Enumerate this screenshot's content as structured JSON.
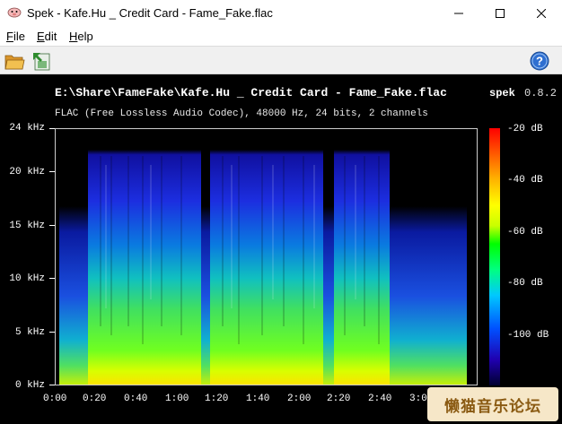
{
  "window": {
    "title": "Spek - Kafe.Hu _ Credit Card - Fame_Fake.flac",
    "icon": "pig-app-icon"
  },
  "menu": [
    {
      "label": "File",
      "accel": "F",
      "rest": "ile"
    },
    {
      "label": "Edit",
      "accel": "E",
      "rest": "dit"
    },
    {
      "label": "Help",
      "accel": "H",
      "rest": "elp"
    }
  ],
  "toolbar": {
    "open_icon": "folder-open-icon",
    "save_icon": "save-screenshot-icon",
    "help_icon": "help-icon"
  },
  "spectrogram": {
    "filename": "E:\\Share\\FameFake\\Kafe.Hu _ Credit Card - Fame_Fake.flac",
    "brand": "spek",
    "version": "0.8.2",
    "info": "FLAC (Free Lossless Audio Codec), 48000 Hz, 24 bits, 2 channels",
    "y_ticks": [
      "24 kHz",
      "20 kHz",
      "15 kHz",
      "10 kHz",
      "5 kHz",
      "0 kHz"
    ],
    "x_ticks": [
      "0:00",
      "0:20",
      "0:40",
      "1:00",
      "1:20",
      "1:40",
      "2:00",
      "2:20",
      "2:40",
      "3:00"
    ],
    "db_ticks": [
      "-20 dB",
      "-40 dB",
      "-60 dB",
      "-80 dB",
      "-100 dB"
    ]
  },
  "watermark": "懒猫音乐论坛"
}
